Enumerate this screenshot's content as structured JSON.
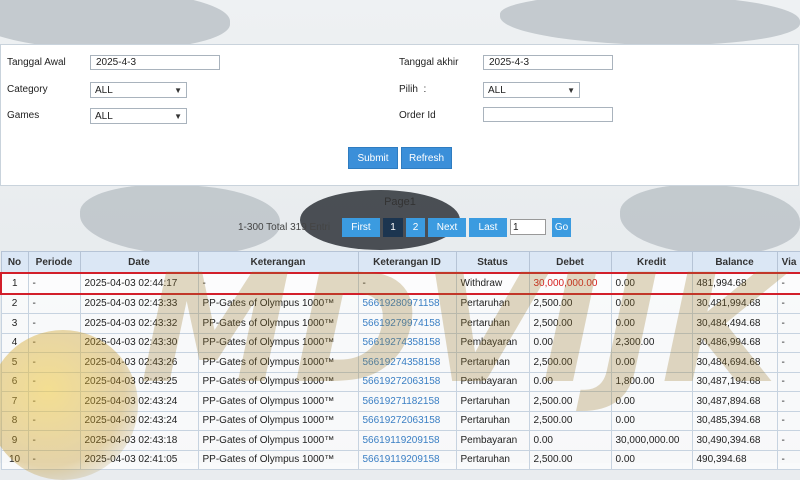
{
  "filters": {
    "start_date_label": "Tanggal Awal",
    "start_date_value": "2025-4-3",
    "end_date_label": "Tanggal akhir",
    "end_date_value": "2025-4-3",
    "category_label": "Category",
    "category_value": "ALL",
    "pilih_label": "Pilih",
    "pilih_colon": ":",
    "pilih_value": "ALL",
    "games_label": "Games",
    "games_value": "ALL",
    "order_id_label": "Order Id",
    "order_id_value": "",
    "submit_label": "Submit",
    "refresh_label": "Refresh"
  },
  "pagination": {
    "title": "Page1",
    "info": "1-300 Total 319 Entri",
    "first": "First",
    "page1": "1",
    "page2": "2",
    "next": "Next",
    "last": "Last",
    "goto_value": "1",
    "go": "Go"
  },
  "table": {
    "headers": [
      "No",
      "Periode",
      "Date",
      "Keterangan",
      "Keterangan ID",
      "Status",
      "Debet",
      "Kredit",
      "Balance",
      "Via"
    ],
    "rows": [
      [
        "1",
        "-",
        "2025-04-03 02:44:17",
        "-",
        "-",
        "Withdraw",
        "30,000,000.00",
        "0.00",
        "481,994.68",
        "-"
      ],
      [
        "2",
        "-",
        "2025-04-03 02:43:33",
        "PP-Gates of Olympus 1000™",
        "56619280971158",
        "Pertaruhan",
        "2,500.00",
        "0.00",
        "30,481,994.68",
        "-"
      ],
      [
        "3",
        "-",
        "2025-04-03 02:43:32",
        "PP-Gates of Olympus 1000™",
        "56619279974158",
        "Pertaruhan",
        "2,500.00",
        "0.00",
        "30,484,494.68",
        "-"
      ],
      [
        "4",
        "-",
        "2025-04-03 02:43:30",
        "PP-Gates of Olympus 1000™",
        "56619274358158",
        "Pembayaran",
        "0.00",
        "2,300.00",
        "30,486,994.68",
        "-"
      ],
      [
        "5",
        "-",
        "2025-04-03 02:43:26",
        "PP-Gates of Olympus 1000™",
        "56619274358158",
        "Pertaruhan",
        "2,500.00",
        "0.00",
        "30,484,694.68",
        "-"
      ],
      [
        "6",
        "-",
        "2025-04-03 02:43:25",
        "PP-Gates of Olympus 1000™",
        "56619272063158",
        "Pembayaran",
        "0.00",
        "1,800.00",
        "30,487,194.68",
        "-"
      ],
      [
        "7",
        "-",
        "2025-04-03 02:43:24",
        "PP-Gates of Olympus 1000™",
        "56619271182158",
        "Pertaruhan",
        "2,500.00",
        "0.00",
        "30,487,894.68",
        "-"
      ],
      [
        "8",
        "-",
        "2025-04-03 02:43:24",
        "PP-Gates of Olympus 1000™",
        "56619272063158",
        "Pertaruhan",
        "2,500.00",
        "0.00",
        "30,485,394.68",
        "-"
      ],
      [
        "9",
        "-",
        "2025-04-03 02:43:18",
        "PP-Gates of Olympus 1000™",
        "56619119209158",
        "Pembayaran",
        "0.00",
        "30,000,000.00",
        "30,490,394.68",
        "-"
      ],
      [
        "10",
        "-",
        "2025-04-03 02:41:05",
        "PP-Gates of Olympus 1000™",
        "56619119209158",
        "Pertaruhan",
        "2,500.00",
        "0.00",
        "490,394.68",
        "-"
      ]
    ]
  },
  "watermark": "MDVIJK"
}
